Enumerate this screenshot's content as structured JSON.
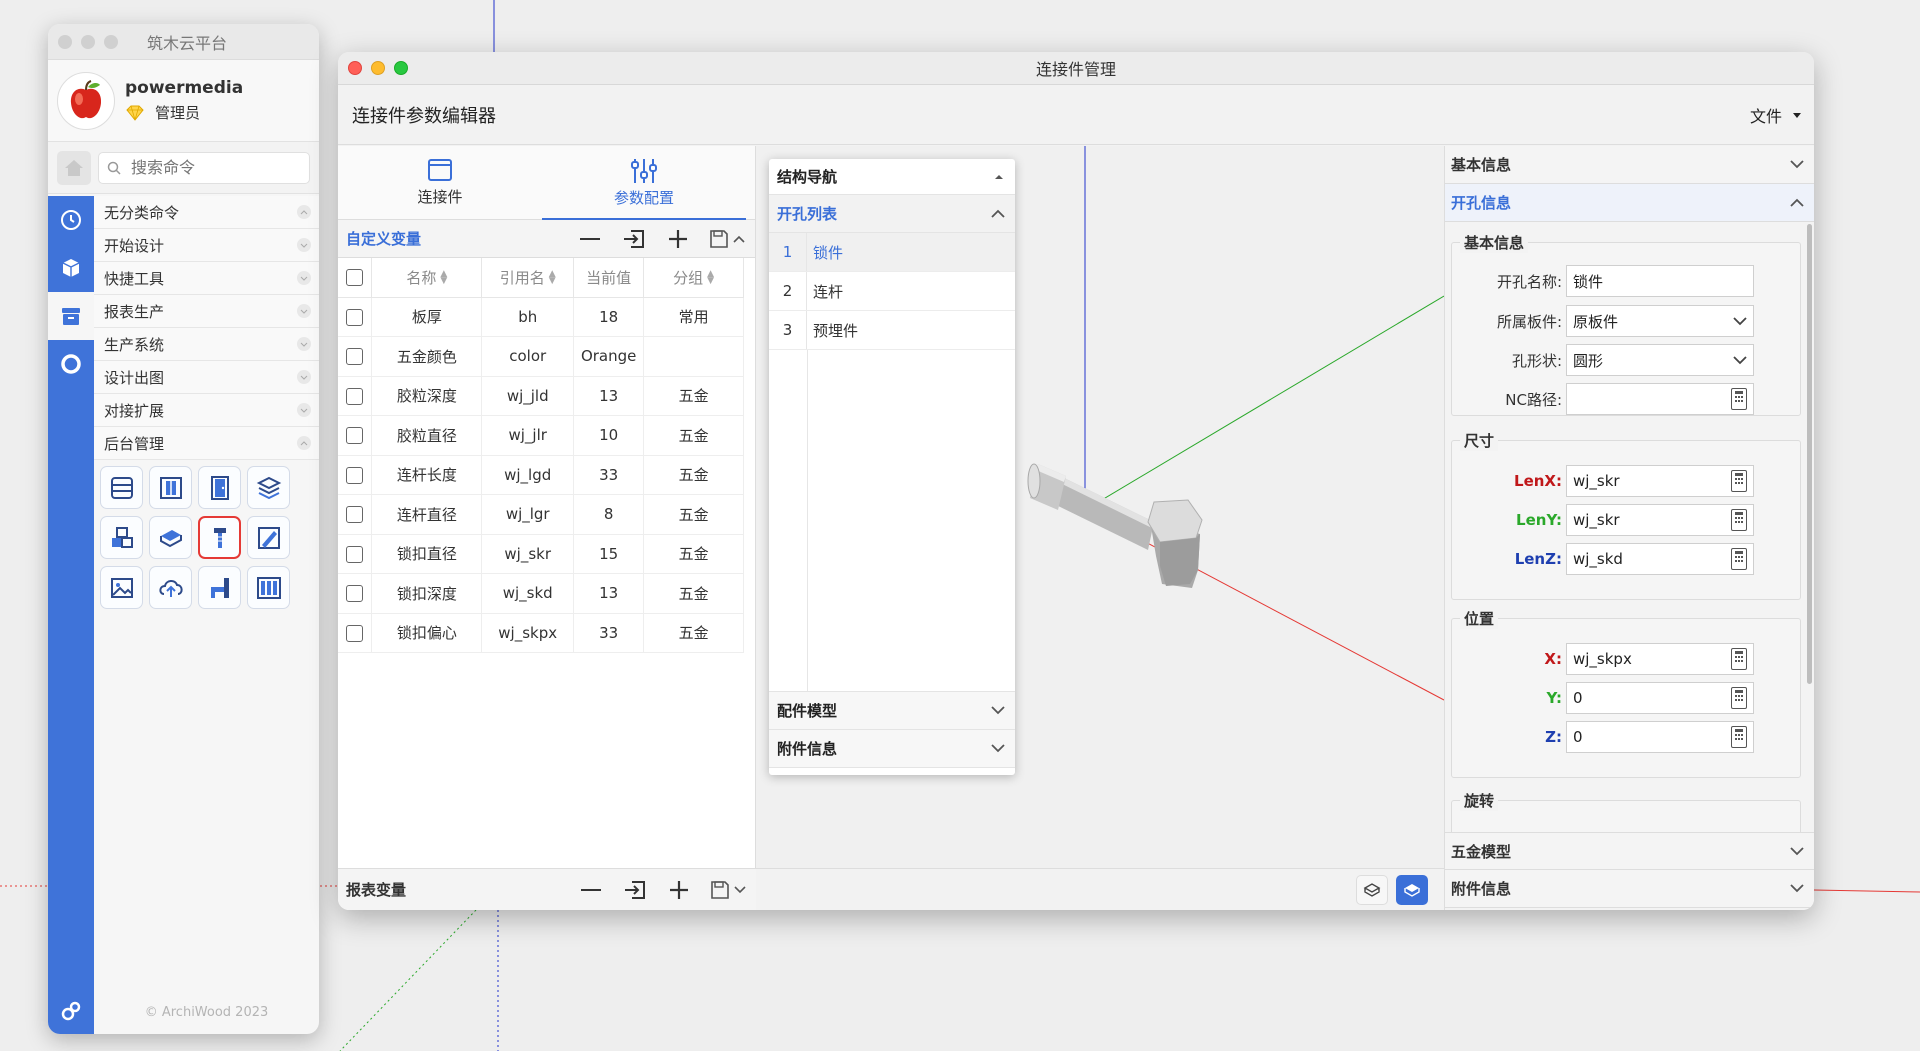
{
  "palette": {
    "title": "筑木云平台",
    "user": {
      "name": "powermedia",
      "role": "管理员"
    },
    "search_placeholder": "搜索命令",
    "categories": [
      "无分类命令",
      "开始设计",
      "快捷工具",
      "报表生产",
      "生产系统",
      "设计出图",
      "对接扩展",
      "后台管理"
    ],
    "tool_icons": [
      "shelves-icon",
      "cabinet-icon",
      "door-icon",
      "layers-icon",
      "boxes-icon",
      "board-icon",
      "connector-icon",
      "pencil-ruler-icon",
      "image-icon",
      "cloud-upload-icon",
      "bracket-icon",
      "panels-icon"
    ],
    "copyright": "© ArchiWood 2023"
  },
  "window": {
    "title": "连接件管理",
    "app_title": "连接件参数编辑器",
    "file_menu": "文件"
  },
  "tabs": [
    {
      "label": "连接件"
    },
    {
      "label": "参数配置"
    }
  ],
  "custom_vars": {
    "title": "自定义变量",
    "columns": [
      "名称",
      "引用名",
      "当前值",
      "分组"
    ],
    "rows": [
      {
        "name": "板厚",
        "ref": "bh",
        "value": "18",
        "group": "常用"
      },
      {
        "name": "五金颜色",
        "ref": "color",
        "value": "Orange",
        "group": ""
      },
      {
        "name": "胶粒深度",
        "ref": "wj_jld",
        "value": "13",
        "group": "五金"
      },
      {
        "name": "胶粒直径",
        "ref": "wj_jlr",
        "value": "10",
        "group": "五金"
      },
      {
        "name": "连杆长度",
        "ref": "wj_lgd",
        "value": "33",
        "group": "五金"
      },
      {
        "name": "连杆直径",
        "ref": "wj_lgr",
        "value": "8",
        "group": "五金"
      },
      {
        "name": "锁扣直径",
        "ref": "wj_skr",
        "value": "15",
        "group": "五金"
      },
      {
        "name": "锁扣深度",
        "ref": "wj_skd",
        "value": "13",
        "group": "五金"
      },
      {
        "name": "锁扣偏心",
        "ref": "wj_skpx",
        "value": "33",
        "group": "五金"
      }
    ]
  },
  "report_vars": {
    "title": "报表变量"
  },
  "nav": {
    "title": "结构导航",
    "hole_list_title": "开孔列表",
    "holes": [
      {
        "idx": "1",
        "name": "锁件"
      },
      {
        "idx": "2",
        "name": "连杆"
      },
      {
        "idx": "3",
        "name": "预埋件"
      }
    ],
    "fittings": "配件模型",
    "attachments": "附件信息"
  },
  "props": {
    "basic_info": "基本信息",
    "hole_info": "开孔信息",
    "basic_group": "基本信息",
    "hole_name_label": "开孔名称:",
    "hole_name": "锁件",
    "board_label": "所属板件:",
    "board": "原板件",
    "shape_label": "孔形状:",
    "shape": "圆形",
    "nc_label": "NC路径:",
    "nc": "",
    "size_group": "尺寸",
    "lenx_label": "LenX:",
    "lenx": "wj_skr",
    "leny_label": "LenY:",
    "leny": "wj_skr",
    "lenz_label": "LenZ:",
    "lenz": "wj_skd",
    "pos_group": "位置",
    "x_label": "X:",
    "x": "wj_skpx",
    "y_label": "Y:",
    "y": "0",
    "z_label": "Z:",
    "z": "0",
    "rot_group": "旋转",
    "hardware_model": "五金模型",
    "attachments": "附件信息"
  },
  "colors": {
    "accent": "#3a6fd8",
    "sidebar": "#3f73d9",
    "axis_x": "#e53935",
    "axis_y": "#2aa82a",
    "axis_z": "#2233cc",
    "selection": "#e53935"
  }
}
